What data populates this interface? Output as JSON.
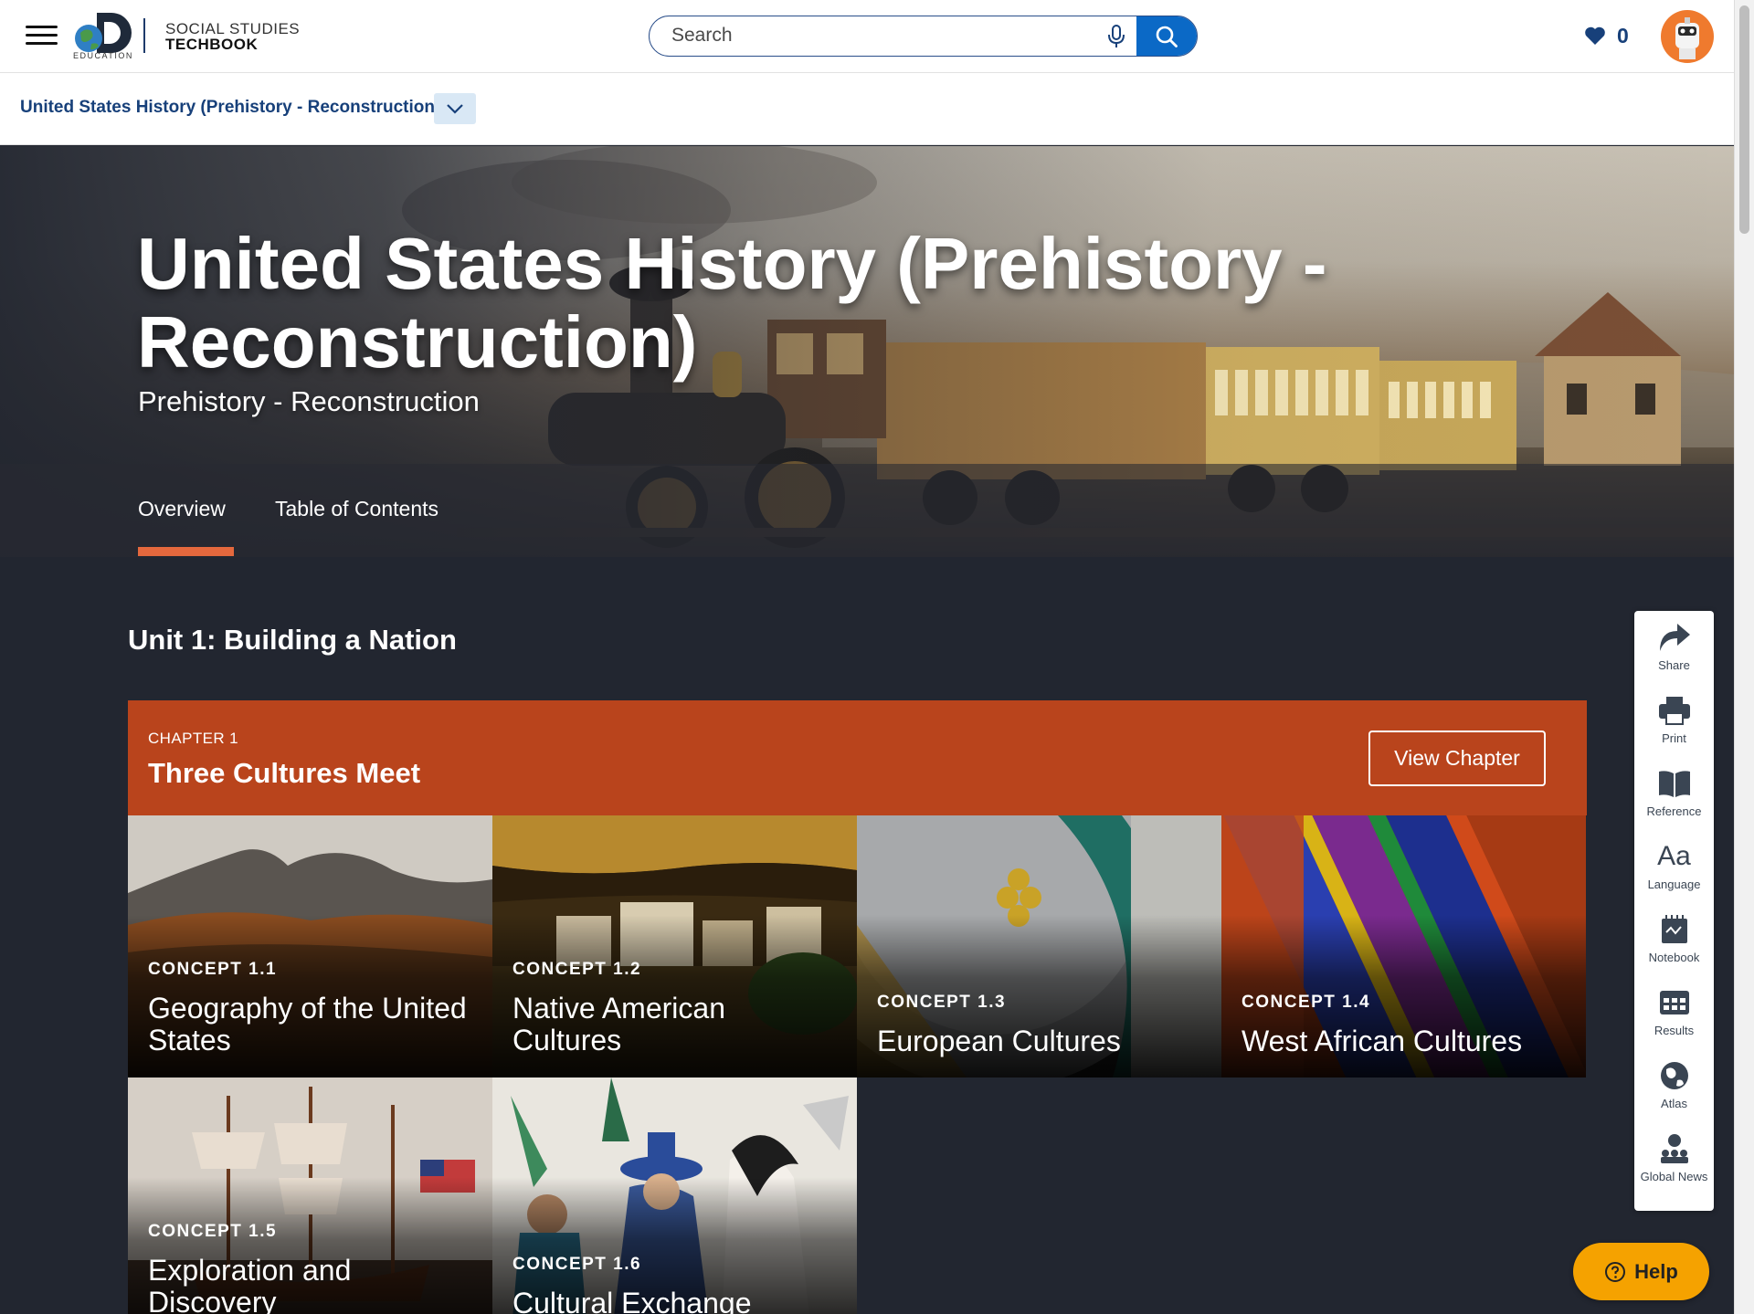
{
  "header": {
    "brand_small": "EDUCATION",
    "brand_line1": "SOCIAL STUDIES",
    "brand_line2": "TECHBOOK",
    "search_placeholder": "Search",
    "favorites_count": "0"
  },
  "breadcrumb": {
    "label": "United States History (Prehistory - Reconstruction)"
  },
  "hero": {
    "title": "United States History (Prehistory - Reconstruction)",
    "subtitle": "Prehistory - Reconstruction",
    "tabs": [
      {
        "label": "Overview",
        "active": true
      },
      {
        "label": "Table of Contents",
        "active": false
      }
    ]
  },
  "unit": {
    "title": "Unit 1: Building a Nation"
  },
  "chapter": {
    "eyebrow": "CHAPTER 1",
    "title": "Three Cultures Meet",
    "button_label": "View Chapter"
  },
  "concepts": [
    {
      "label": "CONCEPT 1.1",
      "title": "Geography of the United States"
    },
    {
      "label": "CONCEPT 1.2",
      "title": "Native American Cultures"
    },
    {
      "label": "CONCEPT 1.3",
      "title": "European Cultures"
    },
    {
      "label": "CONCEPT 1.4",
      "title": "West African Cultures"
    },
    {
      "label": "CONCEPT 1.5",
      "title": "Exploration and Discovery"
    },
    {
      "label": "CONCEPT 1.6",
      "title": "Cultural Exchange"
    }
  ],
  "tools": {
    "share": "Share",
    "print": "Print",
    "reference": "Reference",
    "language_glyph": "Aa",
    "language": "Language",
    "notebook": "Notebook",
    "results": "Results",
    "atlas": "Atlas",
    "global_news": "Global News"
  },
  "help": {
    "label": "Help"
  },
  "colors": {
    "navy": "#17407a",
    "search_blue": "#0b69c6",
    "accent_orange": "#e4683d",
    "chapter_rust": "#b9441c",
    "help_yellow": "#f5a200",
    "page_dark": "#222630"
  }
}
